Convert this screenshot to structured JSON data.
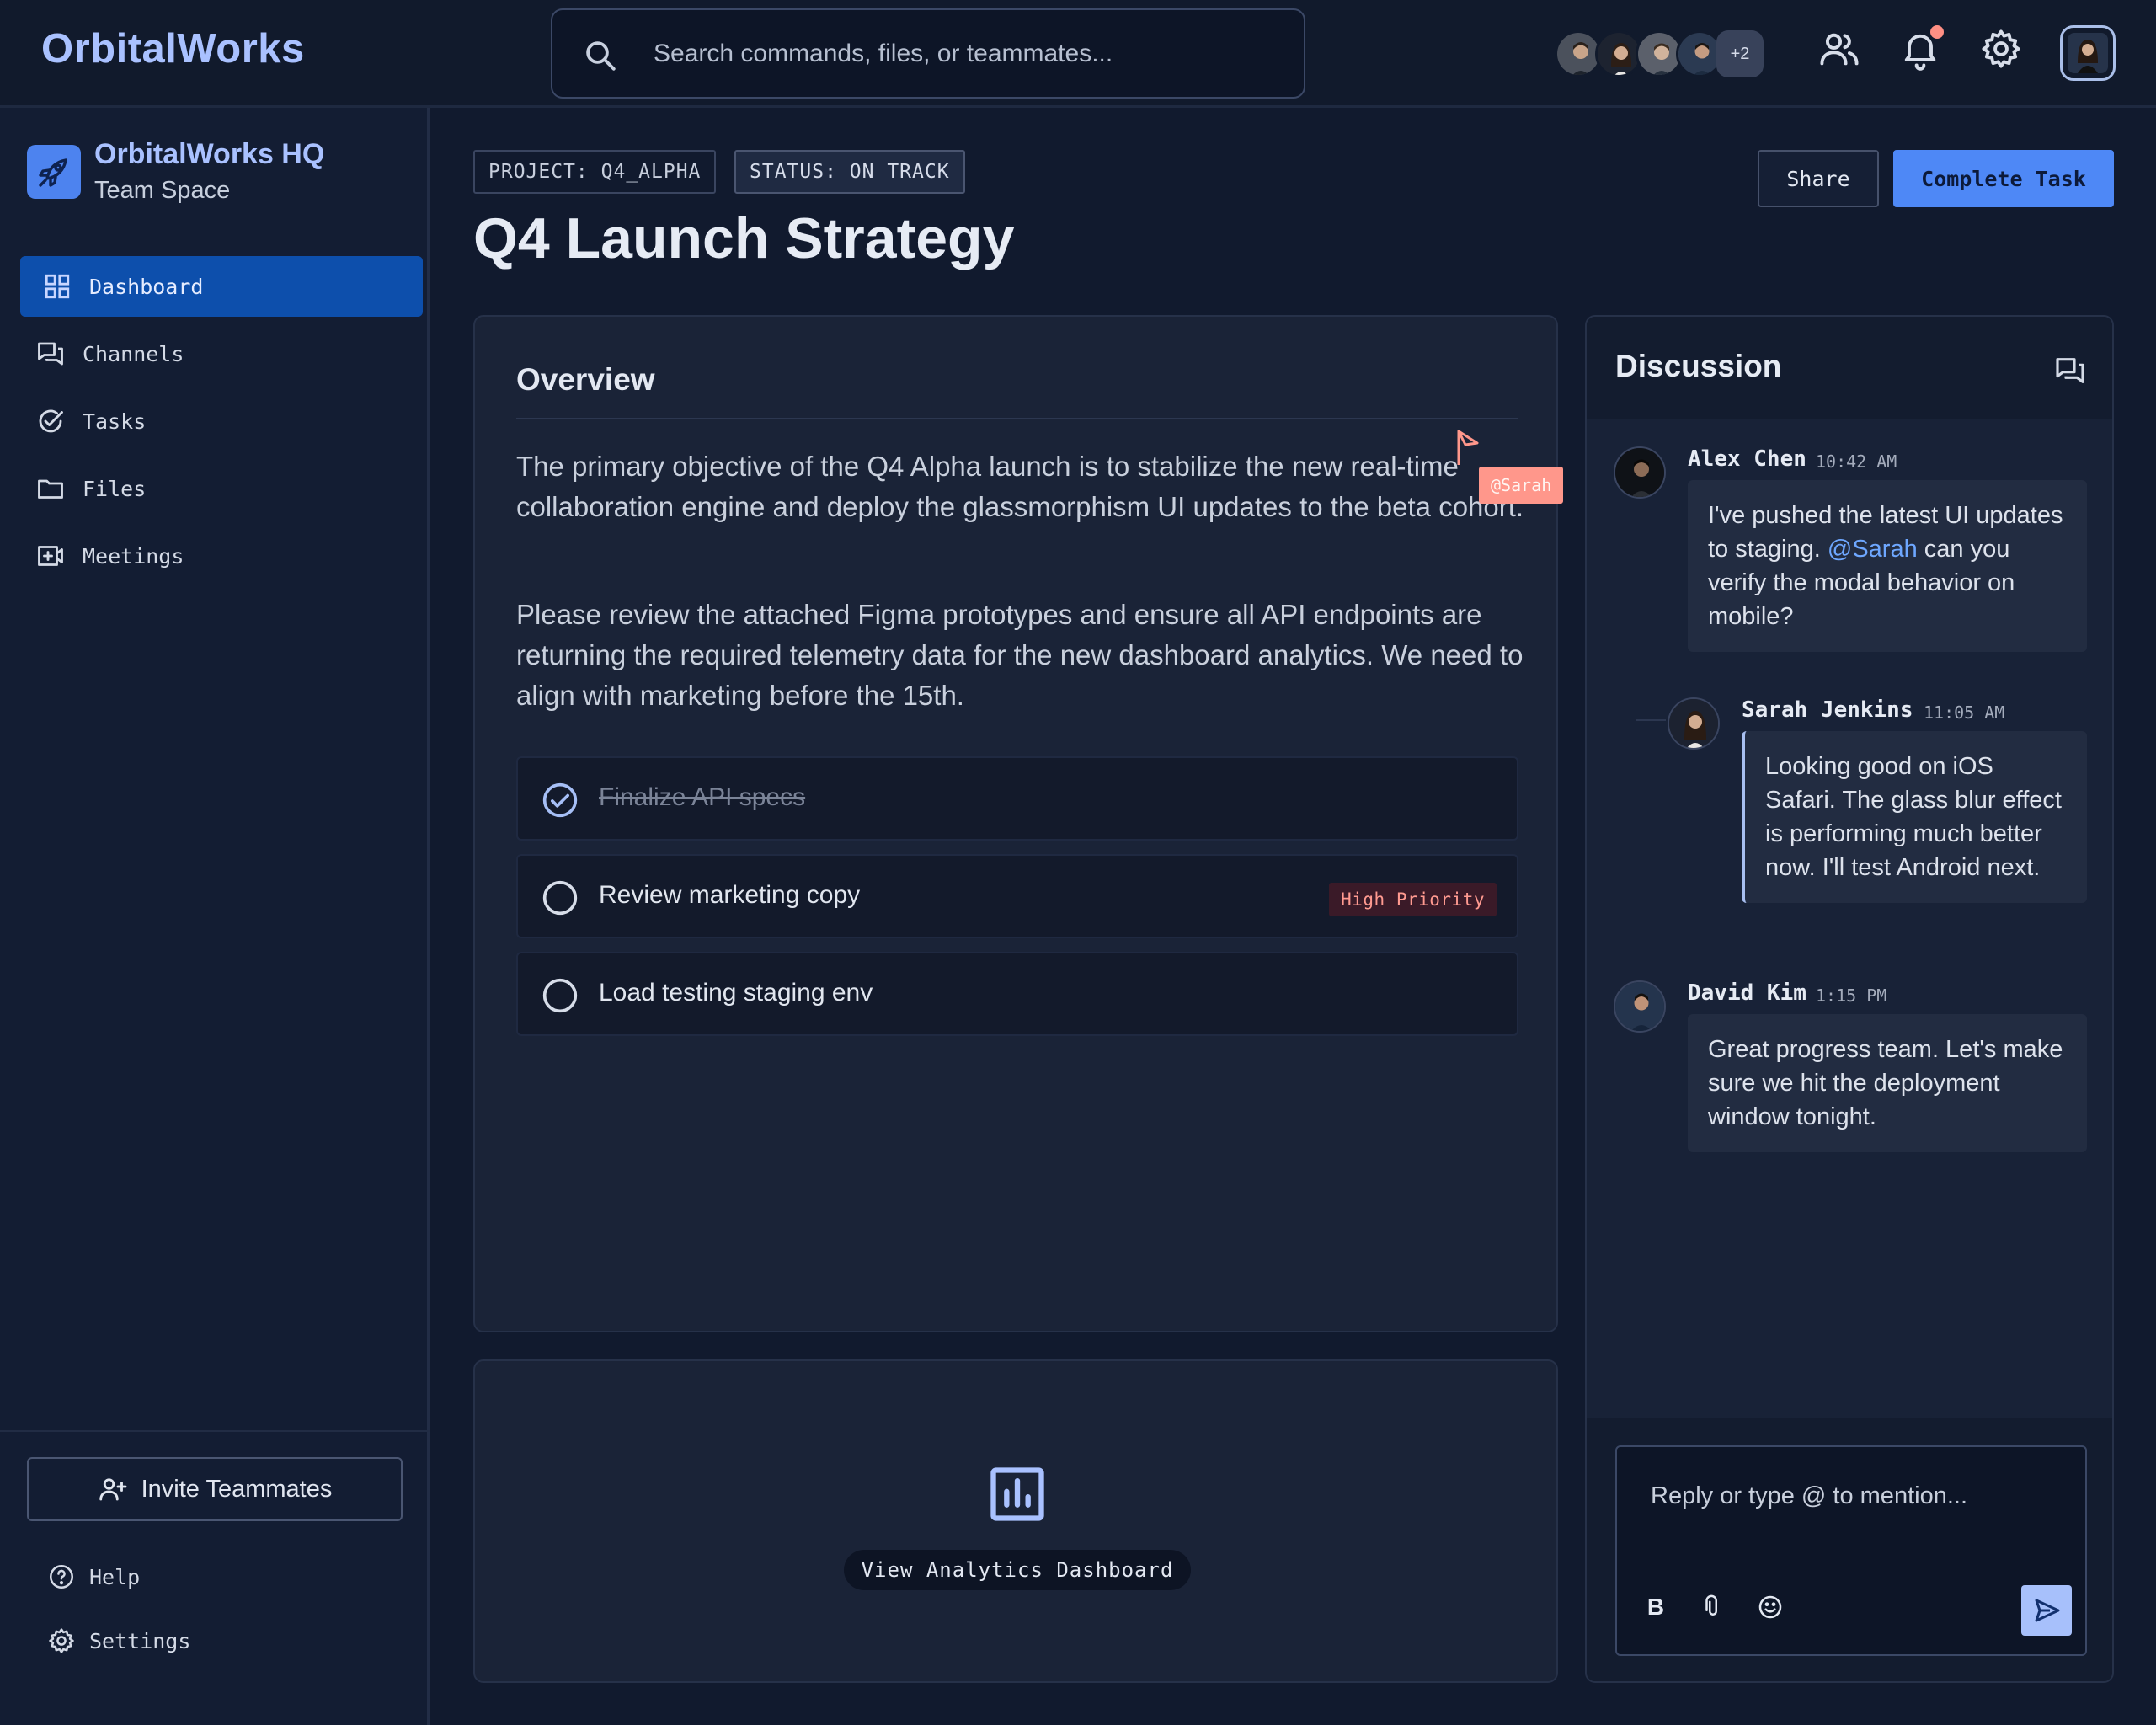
{
  "app": {
    "logo": "OrbitalWorks"
  },
  "search": {
    "placeholder": "Search commands, files, or teammates..."
  },
  "topbar": {
    "presence_more": "+2",
    "icons": [
      "team-icon",
      "bell-icon",
      "gear-icon"
    ],
    "notification_dot_color": "#ff8f84"
  },
  "workspace": {
    "name": "OrbitalWorks HQ",
    "subtitle": "Team Space"
  },
  "sidebar": {
    "items": [
      {
        "label": "Dashboard",
        "icon": "grid-icon",
        "active": true
      },
      {
        "label": "Channels",
        "icon": "chat-icon",
        "active": false
      },
      {
        "label": "Tasks",
        "icon": "check-circle-icon",
        "active": false
      },
      {
        "label": "Files",
        "icon": "folder-icon",
        "active": false
      },
      {
        "label": "Meetings",
        "icon": "video-add-icon",
        "active": false
      }
    ],
    "invite_label": "Invite Teammates",
    "help_label": "Help",
    "settings_label": "Settings"
  },
  "header": {
    "project_tag": "PROJECT: Q4_ALPHA",
    "status_tag": "STATUS: ON TRACK",
    "title": "Q4 Launch Strategy",
    "share_label": "Share",
    "complete_label": "Complete Task"
  },
  "overview": {
    "title": "Overview",
    "paragraph1": "The primary objective of the Q4 Alpha launch is to stabilize the new real-time collaboration engine and deploy the glassmorphism UI updates to the beta cohort.",
    "paragraph2": "Please review the attached Figma prototypes and ensure all API endpoints are returning the required telemetry data for the new dashboard analytics. We need to align with marketing before the 15th.",
    "tasks": [
      {
        "label": "Finalize API specs",
        "done": true,
        "badge": ""
      },
      {
        "label": "Review marketing copy",
        "done": false,
        "badge": "High Priority"
      },
      {
        "label": "Load testing staging env",
        "done": false,
        "badge": ""
      }
    ],
    "cursor_label": "@Sarah"
  },
  "analytics": {
    "label": "View Analytics Dashboard"
  },
  "discussion": {
    "title": "Discussion",
    "messages": [
      {
        "author": "Alex Chen",
        "time": "10:42 AM",
        "text_before": "I've pushed the latest UI updates to staging. ",
        "mention": "@Sarah",
        "text_after": " can you verify the modal behavior on mobile?"
      },
      {
        "author": "Sarah Jenkins",
        "time": "11:05 AM",
        "text": "Looking good on iOS Safari. The glass blur effect is performing much better now. I'll test Android next."
      },
      {
        "author": "David Kim",
        "time": "1:15 PM",
        "text": "Great progress team. Let's make sure we hit the deployment window tonight."
      }
    ],
    "compose_placeholder": "Reply or type @ to mention...",
    "bold_tool": "B"
  },
  "colors": {
    "accent": "#4e88f6",
    "active_nav": "#0d4fac",
    "logo": "#a9c1ff",
    "priority": "#ff9a90",
    "mention": "#6ea7ff"
  }
}
